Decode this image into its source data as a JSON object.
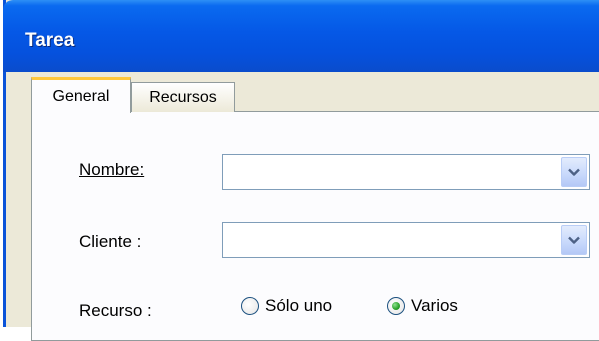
{
  "window": {
    "title": "Tarea"
  },
  "tabs": [
    {
      "label": "General",
      "active": true
    },
    {
      "label": "Recursos",
      "active": false
    }
  ],
  "form": {
    "nombre_label": "Nombre:",
    "nombre_value": "",
    "cliente_label": "Cliente :",
    "cliente_value": "",
    "recurso_label": "Recurso :",
    "recurso_options": [
      {
        "label": "Sólo uno",
        "selected": false
      },
      {
        "label": "Varios",
        "selected": true
      }
    ]
  },
  "icons": {
    "dropdown": "chevron-down-icon",
    "radio_selected": "radio-dot-icon"
  },
  "colors": {
    "titlebar": "#0558e6",
    "tab_highlight": "#ffc83c",
    "dropdown_arrow": "#4d6185"
  }
}
